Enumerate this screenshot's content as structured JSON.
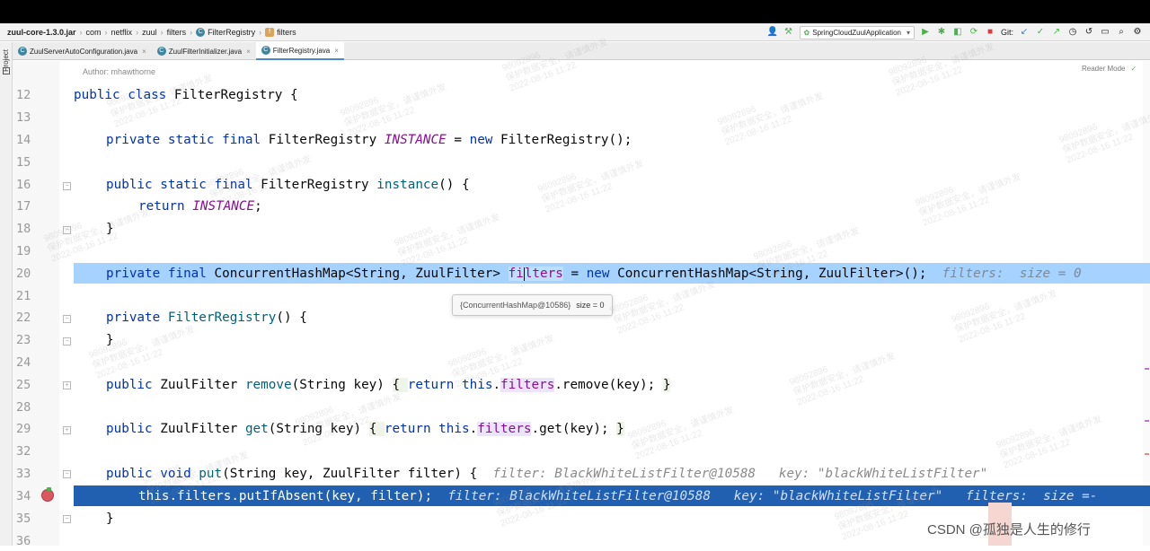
{
  "breadcrumb": {
    "jar": "zuul-core-1.3.0.jar",
    "parts": [
      "com",
      "netflix",
      "zuul",
      "filters"
    ],
    "class": "FilterRegistry",
    "field": "filters"
  },
  "toolbar": {
    "run_config": "SpringCloudZuulApplication",
    "git_label": "Git:"
  },
  "tabs": [
    {
      "label": "ZuulServerAutoConfiguration.java",
      "active": false
    },
    {
      "label": "ZuulFilterInitializer.java",
      "active": false
    },
    {
      "label": "FilterRegistry.java",
      "active": true
    }
  ],
  "side": {
    "project_label": "Project"
  },
  "editor": {
    "author": "Author: mhawthorne",
    "reader_mode": "Reader Mode",
    "line_numbers": [
      "12",
      "13",
      "14",
      "15",
      "16",
      "17",
      "18",
      "19",
      "20",
      "21",
      "22",
      "23",
      "24",
      "25",
      "28",
      "29",
      "32",
      "33",
      "34",
      "35",
      "36"
    ],
    "line12": {
      "kw": "public class",
      "name": "FilterRegistry",
      "rest": " {"
    },
    "line14": {
      "kw": "private static final",
      "type": "FilterRegistry",
      "const": "INSTANCE",
      "eq": " = ",
      "new_kw": "new",
      "rest": " FilterRegistry();"
    },
    "line16": {
      "kw": "public static final",
      "type": "FilterRegistry",
      "method": "instance",
      "rest": "() {"
    },
    "line17": {
      "kw": "return",
      "const": "INSTANCE",
      "rest": ";"
    },
    "line18": "}",
    "line20": {
      "kw": "private final",
      "type": "ConcurrentHashMap<String, ZuulFilter>",
      "field_a": "fi",
      "field_b": "lters",
      "eq": " = ",
      "new_kw": "new",
      "rest": " ConcurrentHashMap<String, ZuulFilter>();",
      "hint": "filters:  size = 0"
    },
    "tooltip": {
      "obj": "{ConcurrentHashMap@10586}",
      "size": "size = 0"
    },
    "line22": {
      "kw": "private",
      "method": "FilterRegistry",
      "rest": "() {"
    },
    "line23": "}",
    "line25": {
      "kw": "public",
      "type": "ZuulFilter",
      "method": "remove",
      "args": "(String key) ",
      "ob": "{ ",
      "ret": "return",
      "this": "this",
      "dot": ".",
      "field": "filters",
      "call": ".remove(key); ",
      "cb": "}"
    },
    "line29": {
      "kw": "public",
      "type": "ZuulFilter",
      "method": "get",
      "args": "(String key) ",
      "ob": "{ ",
      "ret": "return",
      "this": "this",
      "dot": ".",
      "field": "filters",
      "call": ".get(key); ",
      "cb": "}"
    },
    "line33": {
      "kw": "public void",
      "method": "put",
      "args": "(String key, ZuulFilter filter) {",
      "hint": "filter: BlackWhiteListFilter@10588   key: \"blackWhiteListFilter\""
    },
    "line34": {
      "this": "this",
      "dot": ".",
      "field": "filters",
      "call": ".putIfAbsent(key, filter);",
      "hint": "filter: BlackWhiteListFilter@10588   key: \"blackWhiteListFilter\"   filters:  size =-"
    },
    "line35": "}"
  },
  "watermark": {
    "id": "98092896",
    "text": "保护数据安全，请谨慎外发",
    "date": "2022-08-16 11:22"
  },
  "attribution": "CSDN @孤独是人生的修行",
  "colors": {
    "keyword": "#0033b3",
    "constant": "#871094",
    "method": "#00627a",
    "line_highlight": "#a6d2ff",
    "debug_line": "#2160b0",
    "breakpoint": "#db5860"
  }
}
